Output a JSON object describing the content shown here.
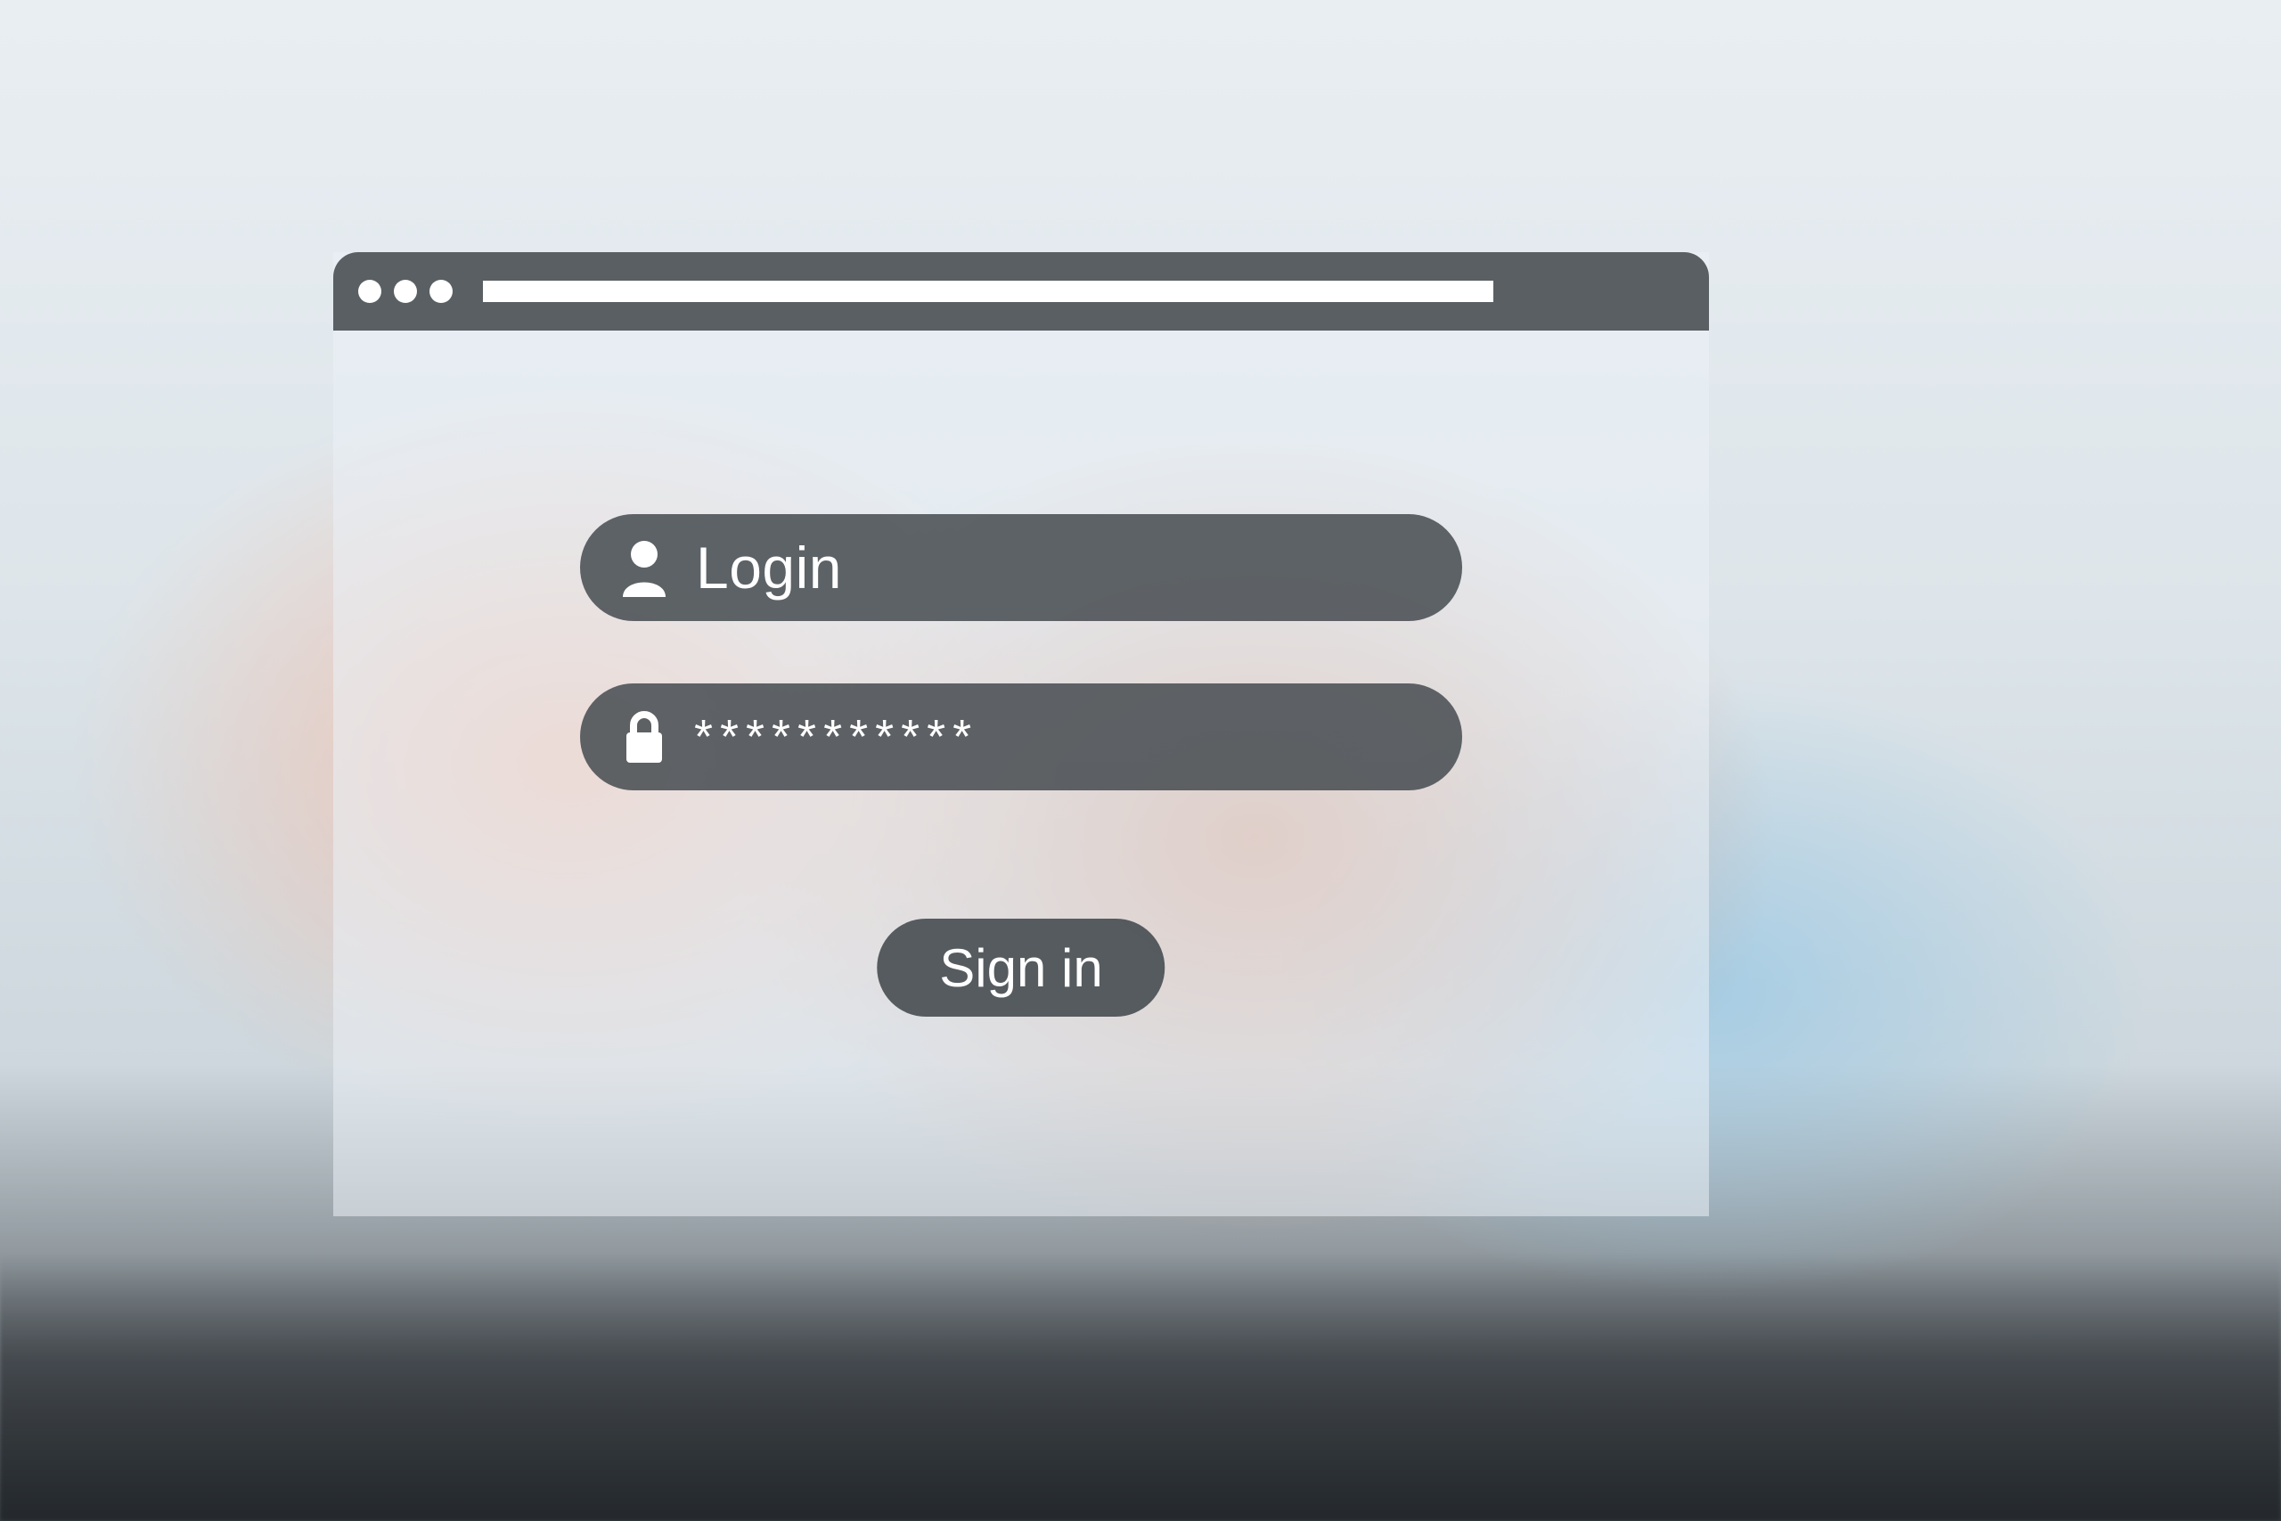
{
  "form": {
    "login_placeholder": "Login",
    "login_value": "",
    "password_masked": "***********",
    "signin_label": "Sign in"
  }
}
